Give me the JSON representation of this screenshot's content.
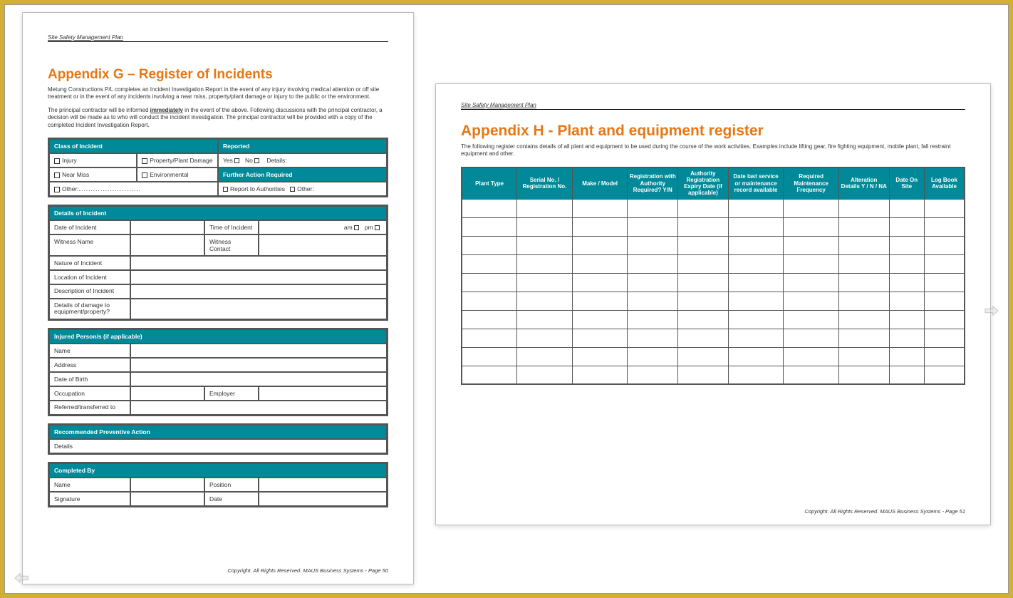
{
  "doc_header": "Site Safety Management Plan",
  "left": {
    "title": "Appendix G – Register of Incidents",
    "intro1": "Metung Constructions P/L  completes an Incident Investigation Report in the event of any injury involving medical attention or off site treatment or in the event of any incidents involving a near miss, property/plant damage or injury to the public or the environment.",
    "intro2a": "The principal contractor will be informed ",
    "intro2b": "immediately",
    "intro2c": " in the event of the above.  Following discussions with the principal contractor, a decision will be made as to who will conduct the incident investigation.  The principal contractor will be provided with a copy of the completed Incident Investigation Report.",
    "class_header": "Class of Incident",
    "reported_header": "Reported",
    "injury": "Injury",
    "property": "Property/Plant Damage",
    "nearmiss": "Near Miss",
    "environmental": "Environmental",
    "other": "Other:",
    "other_dots": "..........................",
    "yes": "Yes",
    "no": "No",
    "details_lbl": "Details:",
    "further_action": "Further Action Required",
    "report_auth": "Report to Authorities",
    "details_header": "Details of Incident",
    "date_incident": "Date of Incident",
    "time_incident": "Time of Incident",
    "am": "am",
    "pm": "pm",
    "witness_name": "Witness Name",
    "witness_contact": "Witness Contact",
    "nature": "Nature of Incident",
    "location": "Location of Incident",
    "description": "Description of Incident",
    "damage": "Details of damage to equipment/property?",
    "injured_header": "Injured Person/s (if applicable)",
    "name": "Name",
    "address": "Address",
    "dob": "Date of Birth",
    "occupation": "Occupation",
    "employer": "Employer",
    "referred": "Referred/transferred to",
    "preventive_header": "Recommended Preventive Action",
    "details": "Details",
    "completed_header": "Completed By",
    "position": "Position",
    "signature": "Signature",
    "date": "Date",
    "footer": "Copyright. All Rights Reserved. MAUS Business Systems - Page 50"
  },
  "right": {
    "title": "Appendix H - Plant and equipment register",
    "intro": "The following register contains details of all plant and equipment to be used during the course of the work activities. Examples include lifting gear, fire fighting equipment, mobile plant, fall restraint equipment and other.",
    "cols": {
      "c1": "Plant Type",
      "c2": "Serial No. / Registration No.",
      "c3": "Make / Model",
      "c4": "Registration with Authority Required? Y/N",
      "c5": "Authority Registration Expiry Date (if applicable)",
      "c6": "Date last service or maintenance record available",
      "c7": "Required Maintenance Frequency",
      "c8": "Alteration Details Y / N / NA",
      "c9": "Date On Site",
      "c10": "Log Book Available"
    },
    "footer": "Copyright. All Rights Reserved. MAUS Business Systems - Page 51"
  }
}
